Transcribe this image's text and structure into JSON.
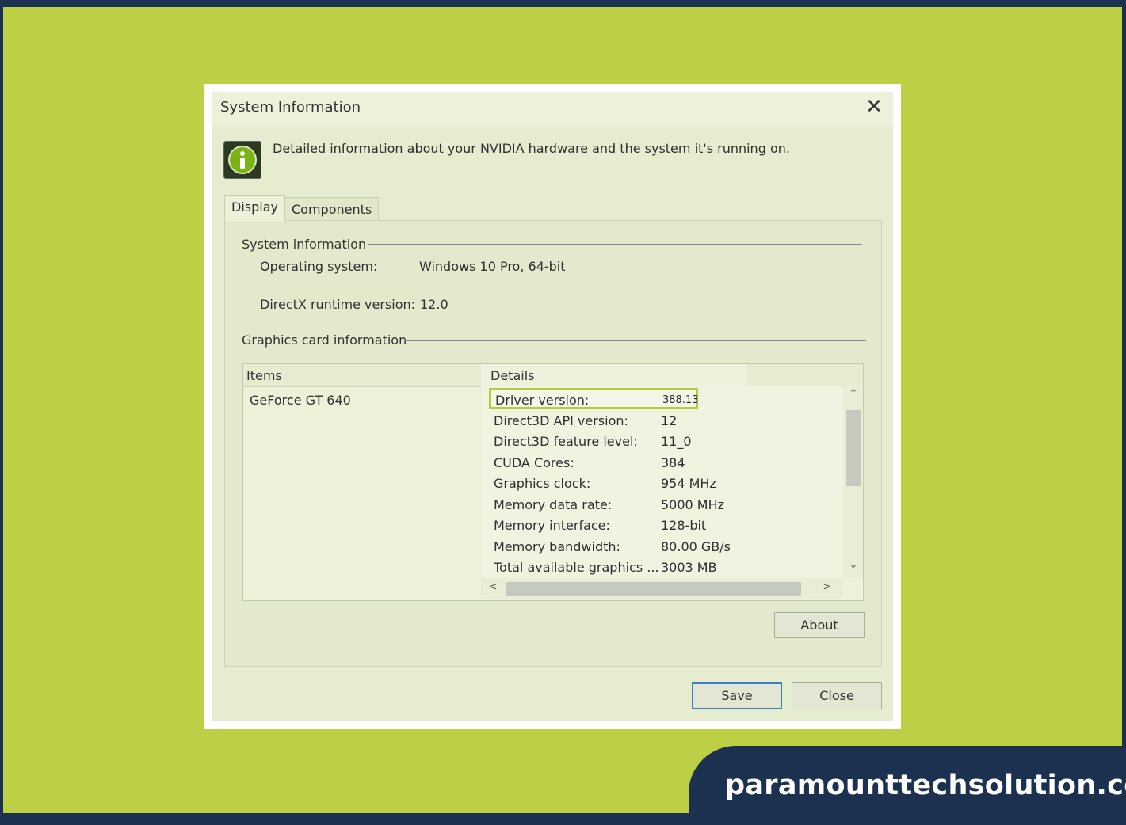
{
  "dialog": {
    "title": "System Information",
    "close_symbol": "✕",
    "icon": "nvidia-info-icon",
    "description": "Detailed information about your NVIDIA hardware and the system it's running on."
  },
  "tabs": [
    {
      "label": "Display",
      "active": true
    },
    {
      "label": "Components",
      "active": false
    }
  ],
  "system_info": {
    "heading": "System information",
    "rows": [
      {
        "label": "Operating system:",
        "value": "Windows 10 Pro, 64-bit"
      },
      {
        "label": "DirectX runtime version:",
        "value": "12.0"
      }
    ]
  },
  "graphics_info": {
    "heading": "Graphics card information",
    "columns": [
      "Items",
      "Details"
    ],
    "item": "GeForce GT 640",
    "details": [
      {
        "label": "Driver version:",
        "value": "388.13",
        "highlighted": true
      },
      {
        "label": "Direct3D API version:",
        "value": "12"
      },
      {
        "label": "Direct3D feature level:",
        "value": "11_0"
      },
      {
        "label": "CUDA Cores:",
        "value": "384"
      },
      {
        "label": "Graphics clock:",
        "value": "954 MHz"
      },
      {
        "label": "Memory data rate:",
        "value": "5000 MHz"
      },
      {
        "label": "Memory interface:",
        "value": "128-bit"
      },
      {
        "label": "Memory bandwidth:",
        "value": "80.00 GB/s"
      },
      {
        "label": "Total available graphics ...",
        "value": "3003 MB"
      }
    ],
    "scroll": {
      "up": "⌃",
      "down": "⌄",
      "left": "<",
      "right": ">"
    }
  },
  "buttons": {
    "about": "About",
    "save": "Save",
    "close": "Close"
  },
  "brand": {
    "text": "paramounttechsolution.com"
  },
  "colors": {
    "page_background": "#bdd045",
    "border_navy": "#1c3150",
    "highlight": "#b5cc3d",
    "save_focus": "#3d7fc4"
  }
}
